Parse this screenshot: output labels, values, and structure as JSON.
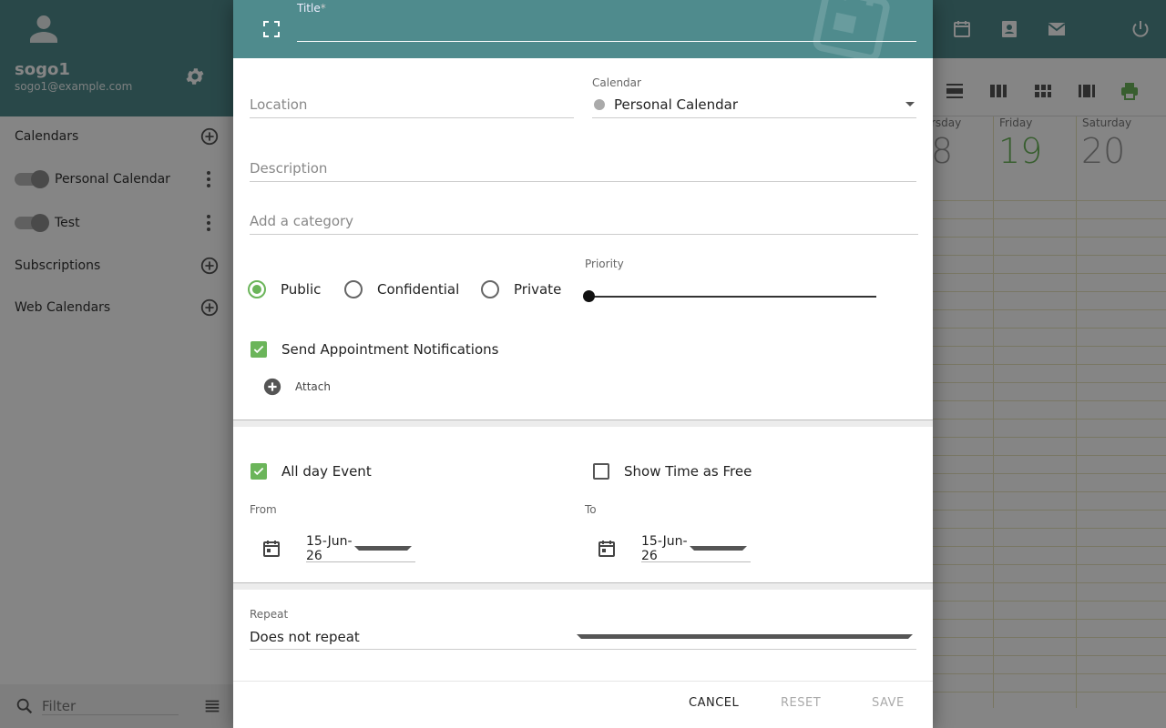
{
  "sidebar": {
    "user": {
      "name": "sogo1",
      "email": "sogo1@example.com"
    },
    "sections": [
      {
        "label": "Calendars"
      },
      {
        "label": "Subscriptions"
      },
      {
        "label": "Web Calendars"
      }
    ],
    "calendars": [
      {
        "label": "Personal Calendar"
      },
      {
        "label": "Test"
      }
    ],
    "filter_placeholder": "Filter"
  },
  "calendar_view": {
    "days": [
      {
        "head": "rsday",
        "num": "8"
      },
      {
        "head": "Friday",
        "num": "19"
      },
      {
        "head": "Saturday",
        "num": "20"
      }
    ]
  },
  "dialog": {
    "title_label": "Title",
    "title_required_marker": "*",
    "title_value": "",
    "location_placeholder": "Location",
    "calendar_label": "Calendar",
    "calendar_value": "Personal Calendar",
    "description_placeholder": "Description",
    "category_placeholder": "Add a category",
    "classification": [
      {
        "label": "Public",
        "checked": true
      },
      {
        "label": "Confidential",
        "checked": false
      },
      {
        "label": "Private",
        "checked": false
      }
    ],
    "priority_label": "Priority",
    "priority_value": 0,
    "send_notifications_label": "Send Appointment Notifications",
    "send_notifications_checked": true,
    "attach_label": "Attach",
    "all_day_label": "All day Event",
    "all_day_checked": true,
    "show_free_label": "Show Time as Free",
    "show_free_checked": false,
    "from_label": "From",
    "from_value": "15-Jun-26",
    "to_label": "To",
    "to_value": "15-Jun-26",
    "repeat_label": "Repeat",
    "repeat_value": "Does not repeat",
    "actions": {
      "cancel": "CANCEL",
      "reset": "RESET",
      "save": "SAVE"
    }
  },
  "colors": {
    "accent": "#4f8b8d",
    "check": "#6bb55a",
    "today": "#6bb55a"
  }
}
